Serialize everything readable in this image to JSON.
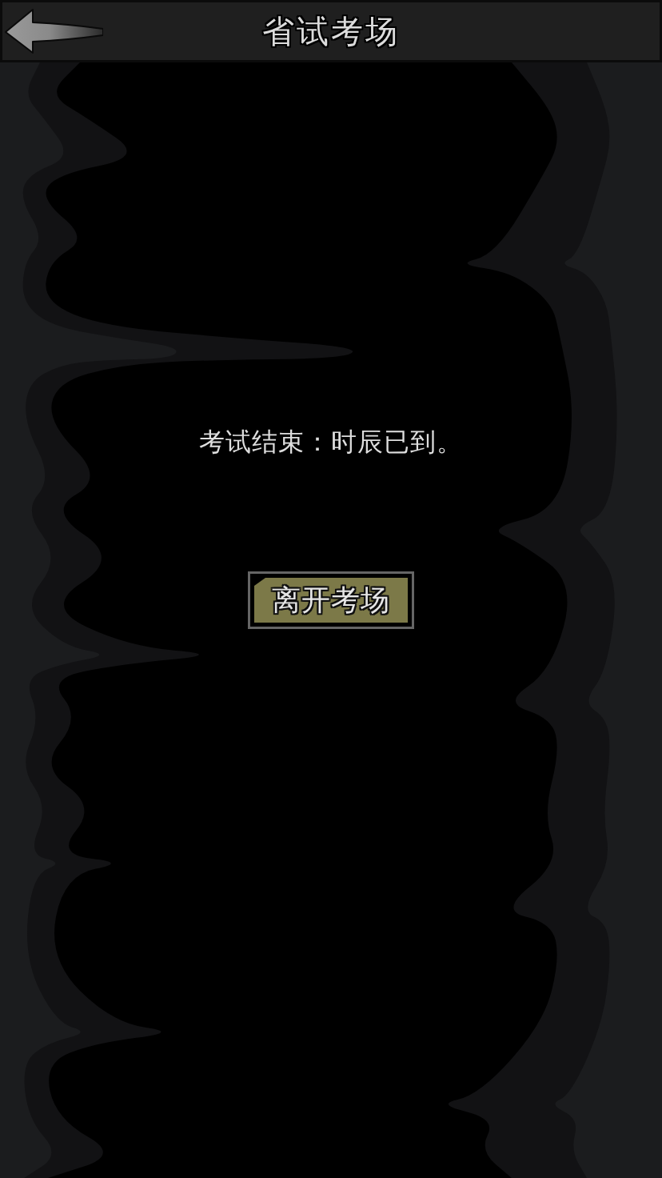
{
  "header": {
    "title": "省试考场"
  },
  "result": {
    "message": "考试结束：时辰已到。"
  },
  "actions": [
    {
      "label": "离开考场"
    }
  ]
}
